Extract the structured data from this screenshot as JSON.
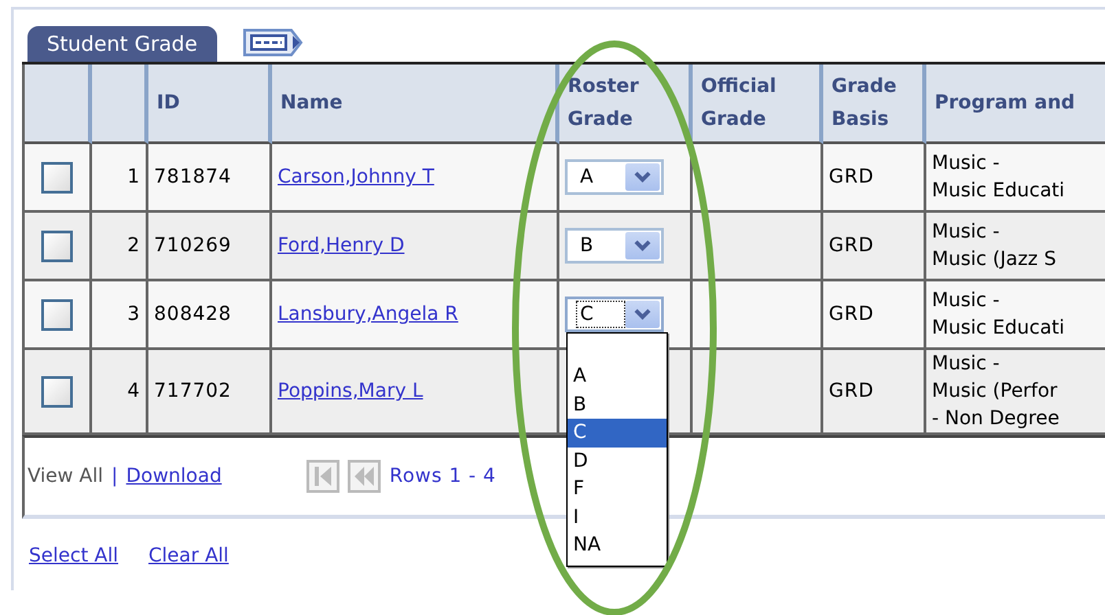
{
  "tabs": [
    {
      "label": "Student Grade",
      "selected": true
    }
  ],
  "table": {
    "columns": [
      "ID",
      "Name",
      "Roster Grade",
      "Official Grade",
      "Grade Basis",
      "Program and"
    ],
    "rows": [
      {
        "checked": false,
        "number": "1",
        "id": "781874",
        "name": "Carson,Johnny T",
        "roster_grade": "A",
        "dropdown_open": false,
        "grade_basis": "GRD",
        "program": [
          "Music -",
          "Music Educati"
        ]
      },
      {
        "checked": false,
        "number": "2",
        "id": "710269",
        "name": "Ford,Henry D",
        "roster_grade": "B",
        "dropdown_open": false,
        "grade_basis": "GRD",
        "program": [
          "Music -",
          "Music (Jazz S"
        ]
      },
      {
        "checked": false,
        "number": "3",
        "id": "808428",
        "name": "Lansbury,Angela R",
        "roster_grade": "C",
        "dropdown_open": true,
        "grade_basis": "GRD",
        "program": [
          "Music -",
          "Music Educati"
        ]
      },
      {
        "checked": false,
        "number": "4",
        "id": "717702",
        "name": "Poppins,Mary L",
        "grade_basis": "GRD",
        "program": [
          "Music -",
          "Music (Perfor",
          "- Non Degree"
        ]
      }
    ]
  },
  "grade_dropdown": {
    "options": [
      {
        "label": "A",
        "selected": false
      },
      {
        "label": "B",
        "selected": false
      },
      {
        "label": "C",
        "selected": true
      },
      {
        "label": "D",
        "selected": false
      },
      {
        "label": "F",
        "selected": false
      },
      {
        "label": "I",
        "selected": false
      },
      {
        "label": "NA",
        "selected": false
      }
    ]
  },
  "footer": {
    "view_all": "View All",
    "separator": "|",
    "download": "Download",
    "rows_text": "Rows 1 - 4"
  },
  "links": [
    "Select All",
    "Clear All"
  ],
  "highlight": {
    "kind": "ellipse"
  }
}
